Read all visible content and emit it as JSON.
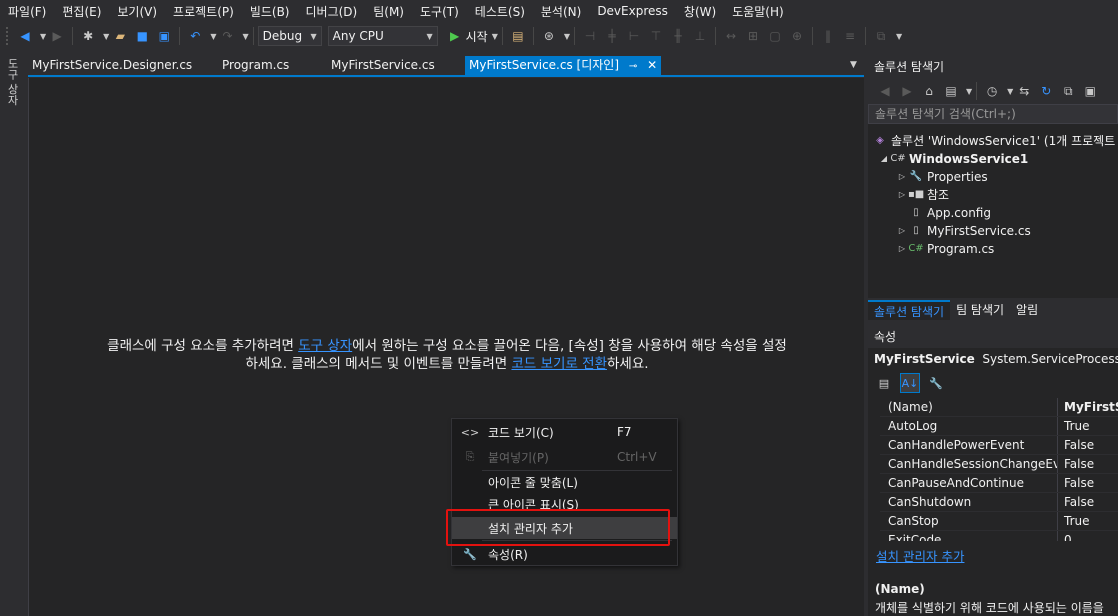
{
  "menu": [
    "파일(F)",
    "편집(E)",
    "보기(V)",
    "프로젝트(P)",
    "빌드(B)",
    "디버그(D)",
    "팀(M)",
    "도구(T)",
    "테스트(S)",
    "분석(N)",
    "DevExpress",
    "창(W)",
    "도움말(H)"
  ],
  "toolbar": {
    "config": "Debug",
    "platform": "Any CPU",
    "start_label": "시작"
  },
  "toolbox_label": "도구 상자",
  "tabs": [
    {
      "label": "MyFirstService.Designer.cs"
    },
    {
      "label": "Program.cs"
    },
    {
      "label": "MyFirstService.cs"
    },
    {
      "label": "MyFirstService.cs [디자인]"
    }
  ],
  "designer": {
    "hint_part1": "클래스에 구성 요소를 추가하려면 ",
    "hint_link1": "도구 상자",
    "hint_part2": "에서 원하는 구성 요소를 끌어온 다음, [속성] 창을 사용하여 해당 속성을 설정",
    "hint_part3": "하세요. 클래스의 메서드 및 이벤트를 만들려면 ",
    "hint_link2": "코드 보기로 전환",
    "hint_part4": "하세요."
  },
  "context_menu": {
    "items": [
      {
        "label": "코드 보기(C)",
        "shortcut": "F7",
        "icon": "code-icon"
      },
      {
        "label": "붙여넣기(P)",
        "shortcut": "Ctrl+V",
        "icon": "paste-icon",
        "disabled": true
      },
      {
        "label": "아이콘 줄 맞춤(L)",
        "shortcut": ""
      },
      {
        "label": "큰 아이콘 표시(S)",
        "shortcut": ""
      },
      {
        "label": "설치 관리자 추가",
        "shortcut": ""
      },
      {
        "label": "속성(R)",
        "shortcut": "",
        "icon": "wrench-icon"
      }
    ]
  },
  "solution_explorer": {
    "title": "솔루션 탐색기",
    "search_placeholder": "솔루션 탐색기 검색(Ctrl+;)",
    "tree": [
      {
        "label": "솔루션 'WindowsService1' (1개 프로젝트"
      },
      {
        "label": "WindowsService1"
      },
      {
        "label": "Properties"
      },
      {
        "label": "참조"
      },
      {
        "label": "App.config"
      },
      {
        "label": "MyFirstService.cs"
      },
      {
        "label": "Program.cs"
      }
    ],
    "bottom_tabs": [
      "솔루션 탐색기",
      "팀 탐색기",
      "알림"
    ]
  },
  "properties": {
    "title": "속성",
    "object_name": "MyFirstService",
    "object_type": "System.ServiceProcess.ServiceBase",
    "rows": [
      {
        "name": "(Name)",
        "value": "MyFirstService"
      },
      {
        "name": "AutoLog",
        "value": "True"
      },
      {
        "name": "CanHandlePowerEvent",
        "value": "False"
      },
      {
        "name": "CanHandleSessionChangeEvent",
        "value": "False"
      },
      {
        "name": "CanPauseAndContinue",
        "value": "False"
      },
      {
        "name": "CanShutdown",
        "value": "False"
      },
      {
        "name": "CanStop",
        "value": "True"
      },
      {
        "name": "ExitCode",
        "value": "0"
      }
    ],
    "link": "설치 관리자 추가",
    "desc_title": "(Name)",
    "desc_text": "개체를 식별하기 위해 코드에 사용되는 이름을"
  },
  "colors": {
    "accent": "#007acc",
    "link": "#3794ff",
    "highlight_box": "#e3120f"
  }
}
